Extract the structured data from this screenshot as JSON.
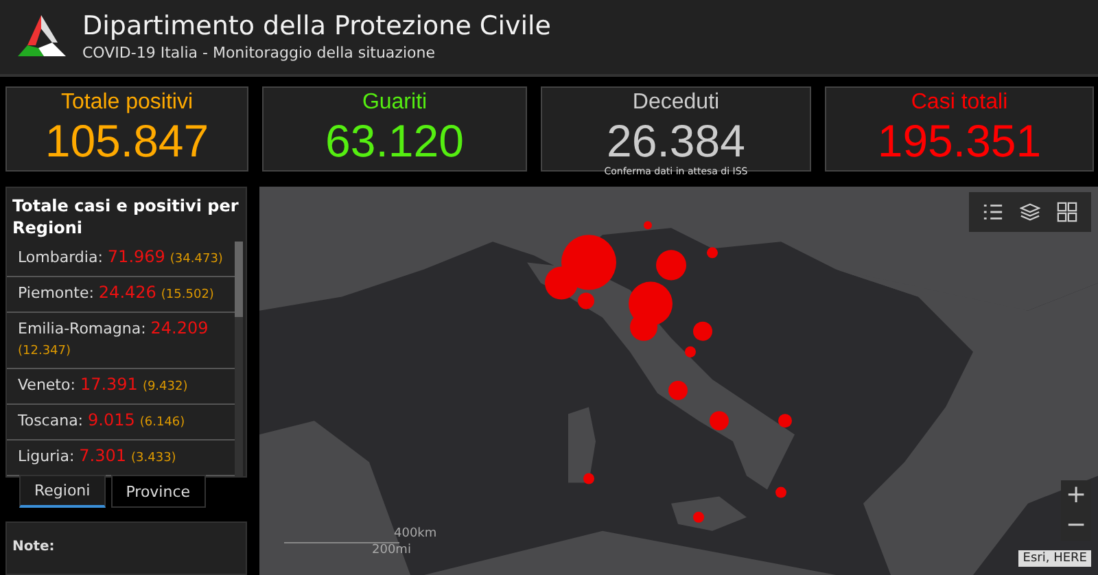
{
  "header": {
    "title": "Dipartimento della Protezione Civile",
    "subtitle": "COVID-19 Italia - Monitoraggio della situazione"
  },
  "cards": [
    {
      "label": "Totale positivi",
      "value": "105.847",
      "color": "#ffaa00"
    },
    {
      "label": "Guariti",
      "value": "63.120",
      "color": "#55ee11"
    },
    {
      "label": "Deceduti",
      "value": "26.384",
      "note": "Conferma dati in attesa di ISS",
      "color": "#cccccc"
    },
    {
      "label": "Casi totali",
      "value": "195.351",
      "color": "#ff0000"
    }
  ],
  "regions_panel": {
    "title": "Totale casi e positivi per Regioni",
    "items": [
      {
        "name": "Lombardia:",
        "total": "71.969",
        "positive": "(34.473)"
      },
      {
        "name": "Piemonte:",
        "total": "24.426",
        "positive": "(15.502)"
      },
      {
        "name": "Emilia-Romagna:",
        "total": "24.209",
        "positive": "(12.347)"
      },
      {
        "name": "Veneto:",
        "total": "17.391",
        "positive": "(9.432)"
      },
      {
        "name": "Toscana:",
        "total": "9.015",
        "positive": "(6.146)"
      },
      {
        "name": "Liguria:",
        "total": "7.301",
        "positive": "(3.433)"
      }
    ]
  },
  "tabs": [
    {
      "label": "Regioni",
      "selected": true
    },
    {
      "label": "Province",
      "selected": false
    }
  ],
  "note": {
    "label": "Note:"
  },
  "map": {
    "scale": [
      "400km",
      "200mi"
    ],
    "zoom_buttons": [
      "+",
      "−"
    ],
    "attribution": "Esri, HERE"
  }
}
